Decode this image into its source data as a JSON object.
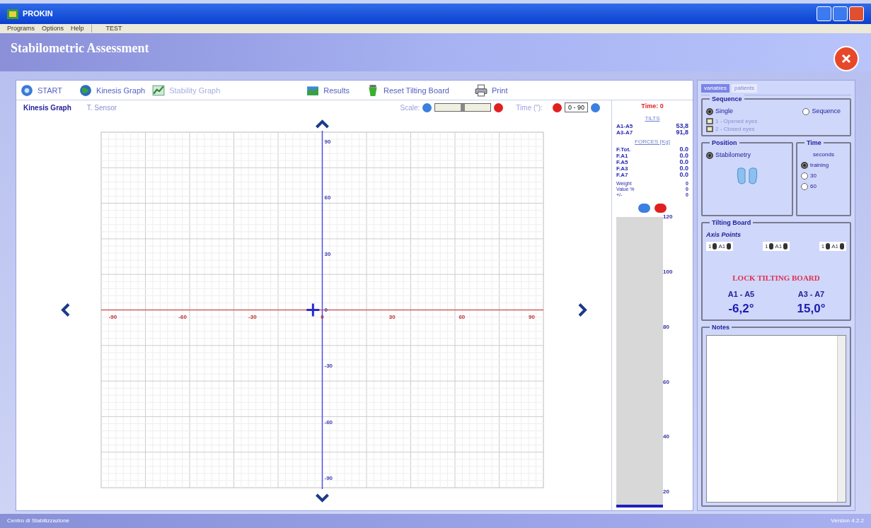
{
  "window": {
    "title": "PROKIN"
  },
  "menu": [
    "Programs",
    "Options",
    "Help",
    "TEST"
  ],
  "header": {
    "title": "Stabilometric Assessment"
  },
  "toolbar": [
    {
      "label": "START",
      "kind": "start",
      "disabled": false
    },
    {
      "label": "Kinesis Graph",
      "kind": "globe",
      "disabled": false
    },
    {
      "label": "Stability Graph",
      "kind": "chart",
      "disabled": true
    },
    {
      "label": "Results",
      "kind": "results",
      "disabled": false
    },
    {
      "label": "Reset Tilting Board",
      "kind": "reset",
      "disabled": false
    },
    {
      "label": "Print",
      "kind": "print",
      "disabled": false
    }
  ],
  "graph_tabs": [
    {
      "label": "Kinesis Graph",
      "selected": true
    },
    {
      "label": "T. Sensor",
      "selected": false
    }
  ],
  "scale": {
    "label": "Scale:",
    "level": 0.5
  },
  "time_setting": {
    "label": "Time (\"):",
    "value": "0 - 90"
  },
  "graph": {
    "chart_data": {
      "type": "scatter",
      "grid": true,
      "xlim": [
        -95,
        95
      ],
      "ylim": [
        -95,
        95
      ],
      "xticks": [
        {
          "value": -90,
          "label": "-90"
        },
        {
          "value": -60,
          "label": "-60"
        },
        {
          "value": -30,
          "label": "-30"
        },
        {
          "value": 0,
          "label": "0"
        },
        {
          "value": 30,
          "label": "30"
        },
        {
          "value": 60,
          "label": "60"
        },
        {
          "value": 90,
          "label": "90"
        }
      ],
      "yticks": [
        {
          "value": -90,
          "label": "-90"
        },
        {
          "value": -60,
          "label": "-60"
        },
        {
          "value": -30,
          "label": "-30"
        },
        {
          "value": 0,
          "label": "0"
        },
        {
          "value": 30,
          "label": "30"
        },
        {
          "value": 60,
          "label": "60"
        },
        {
          "value": 90,
          "label": "90"
        }
      ],
      "x": [
        -4
      ],
      "series": [
        {
          "color": "#2a2ad0",
          "values": [
            0
          ]
        }
      ]
    }
  },
  "readout": {
    "timer": "Time: 0",
    "tilts_title": "TILTS",
    "tilts": [
      {
        "label": "A1-A5",
        "value": "53,8"
      },
      {
        "label": "A3-A7",
        "value": "91,8"
      }
    ],
    "forces_title": "FORCES [Kg]",
    "forces": [
      {
        "label": "F.Tot.",
        "value": "0.0"
      },
      {
        "label": "F.A1",
        "value": "0.0"
      },
      {
        "label": "F.A5",
        "value": "0.0"
      },
      {
        "label": "F.A3",
        "value": "0.0"
      },
      {
        "label": "F.A7",
        "value": "0.0"
      }
    ],
    "stats": [
      {
        "label": "Weight",
        "value": "0"
      },
      {
        "label": "Value %",
        "value": "0"
      },
      {
        "label": "+/-",
        "value": "0"
      }
    ]
  },
  "gauge": {
    "level": 0.01,
    "ticks": [
      "120",
      "100",
      "80",
      "60",
      "40",
      "20"
    ]
  },
  "side_tabs": [
    {
      "label": "variables",
      "selected": true
    },
    {
      "label": "patients",
      "selected": false
    }
  ],
  "sequence": {
    "title": "Sequence",
    "options": [
      {
        "label": "Single",
        "selected": true
      },
      {
        "label": "Sequence",
        "selected": false
      }
    ],
    "steps": [
      {
        "label": "1 - Opened eyes",
        "checked": false,
        "disabled": true
      },
      {
        "label": "2 - Closed eyes",
        "checked": false,
        "disabled": true
      }
    ]
  },
  "position": {
    "title": "Position",
    "options": [
      {
        "label": "Stabilometry",
        "selected": true
      }
    ]
  },
  "time": {
    "title": "Time",
    "unit": "seconds",
    "options": [
      {
        "label": "training",
        "selected": true
      },
      {
        "label": "30",
        "selected": false
      },
      {
        "label": "60",
        "selected": false
      }
    ]
  },
  "tilting_board": {
    "title": "Tilting Board",
    "subtitle": "Axis Points",
    "spinners": [
      {
        "value": "1",
        "axis": "A1"
      },
      {
        "value": "1",
        "axis": "A1"
      },
      {
        "value": "1",
        "axis": "A1"
      }
    ],
    "lock_label": "LOCK TILTING BOARD",
    "angles": [
      {
        "label": "A1 - A5",
        "value": "-6,2°"
      },
      {
        "label": "A3 - A7",
        "value": "15,0°"
      }
    ]
  },
  "notes": {
    "title": "Notes"
  },
  "status_bar": {
    "left": "Centro di Stabilizzazione",
    "right": "Version 4.2.2"
  }
}
